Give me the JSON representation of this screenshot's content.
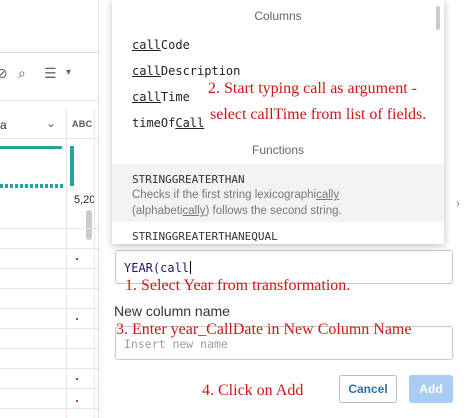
{
  "grid": {
    "column_label": "a",
    "type_badge": "ABC",
    "cell_value": "5,20"
  },
  "toolbar": {
    "icons": [
      "eye-off-icon",
      "person-search-icon",
      "tune-icon",
      "chevron-down-icon"
    ]
  },
  "popup": {
    "columns_heading": "Columns",
    "fields": [
      {
        "match": "call",
        "rest": "Code",
        "prefix": ""
      },
      {
        "match": "call",
        "rest": "Description",
        "prefix": ""
      },
      {
        "match": "call",
        "rest": "Time",
        "prefix": ""
      },
      {
        "match": "Call",
        "rest": "",
        "prefix": "timeOf"
      }
    ],
    "functions_heading": "Functions",
    "function": {
      "name": "STRINGGREATERTHAN",
      "desc_1": "Checks if the first string lexicographi",
      "desc_1_match": "cally",
      "desc_2_pre": "(alphabeti",
      "desc_2_match": "cally",
      "desc_2_post": ") follows the second string."
    },
    "next_function": "STRINGGREATERTHANEQUAL"
  },
  "expression": {
    "value": "YEAR(call"
  },
  "new_column": {
    "label": "New column name",
    "placeholder": "Insert new name"
  },
  "buttons": {
    "cancel": "Cancel",
    "add": "Add"
  },
  "annotations": {
    "step1": "1. Select Year from transformation.",
    "step2_line1": "2. Start typing call as argument -",
    "step2_line2": "select callTime from list of fields.",
    "step3": "3. Enter year_CallDate in New Column Name",
    "step4": "4. Click on Add"
  },
  "colors": {
    "accent_teal": "#23a6a0",
    "annotation_red": "#d01414",
    "add_button_disabled": "#a9cdf2",
    "link_blue": "#2b6cb0"
  }
}
